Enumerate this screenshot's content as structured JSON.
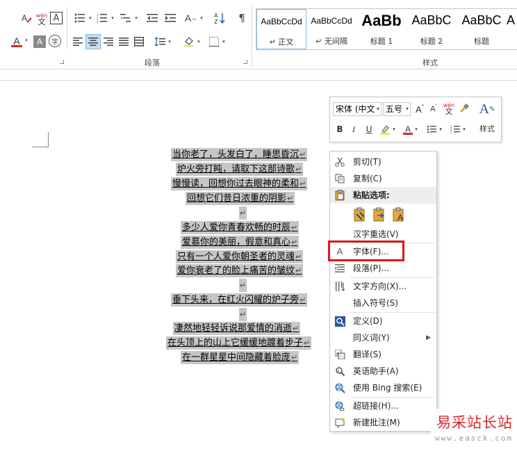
{
  "ribbon": {
    "paragraph_group_label": "段落",
    "styles_group_label": "样式",
    "font_color_accent": "#d9262b",
    "styles": [
      {
        "preview": "AaBbCcDd",
        "name": "↵ 正文"
      },
      {
        "preview": "AaBbCcDd",
        "name": "↵ 无间隔"
      },
      {
        "preview": "AaBb",
        "name": "标题 1"
      },
      {
        "preview": "AaBbC",
        "name": "标题 2"
      },
      {
        "preview": "AaBbC",
        "name": "标题"
      }
    ],
    "phonetic_label": "wén",
    "phonetic_char": "文",
    "char_border_label": "A",
    "enclose_char_label": "字"
  },
  "document": {
    "paragraph_mark": "↵",
    "poem_lines": [
      "当你老了，头发白了，睡思昏沉",
      "炉火旁打盹，请取下这部诗歌",
      "慢慢读，回想你过去眼神的柔和",
      "回想它们昔日浓重的阴影",
      "多少人爱你青春欢畅的时辰",
      "爱慕你的美丽，假意和真心",
      "只有一个人爱你朝圣者的灵魂",
      "爱你衰老了的脸上痛苦的皱纹",
      "垂下头来，在红火闪耀的炉子旁",
      "凄然地轻轻诉说那爱情的消逝",
      "在头顶上的山上它缓缓地踱着步子",
      "在一群星星中间隐藏着脸庞"
    ]
  },
  "mini_toolbar": {
    "font_name": "宋体 (中文",
    "font_size": "五号",
    "styles_label": "样式",
    "bold": "B",
    "italic": "I",
    "underline": "U",
    "phonetic_label": "wén",
    "phonetic_char": "文"
  },
  "context_menu": {
    "items": {
      "cut": "剪切(T)",
      "copy": "复制(C)",
      "paste_options": "粘贴选项:",
      "hanzi_reselect": "汉字重选(V)",
      "font": "字体(F)...",
      "paragraph": "段落(P)...",
      "text_direction": "文字方向(X)...",
      "insert_symbol": "插入符号(S)",
      "define": "定义(D)",
      "synonyms": "同义词(Y)",
      "translate": "翻译(S)",
      "english_assistant": "英语助手(A)",
      "bing_search": "使用 Bing 搜索(E)",
      "hyperlink": "超链接(H)...",
      "new_comment": "新建批注(M)"
    },
    "highlight_color": "#e0141b"
  },
  "watermark": {
    "text": "易采站长站",
    "url": "www.easck.com"
  }
}
